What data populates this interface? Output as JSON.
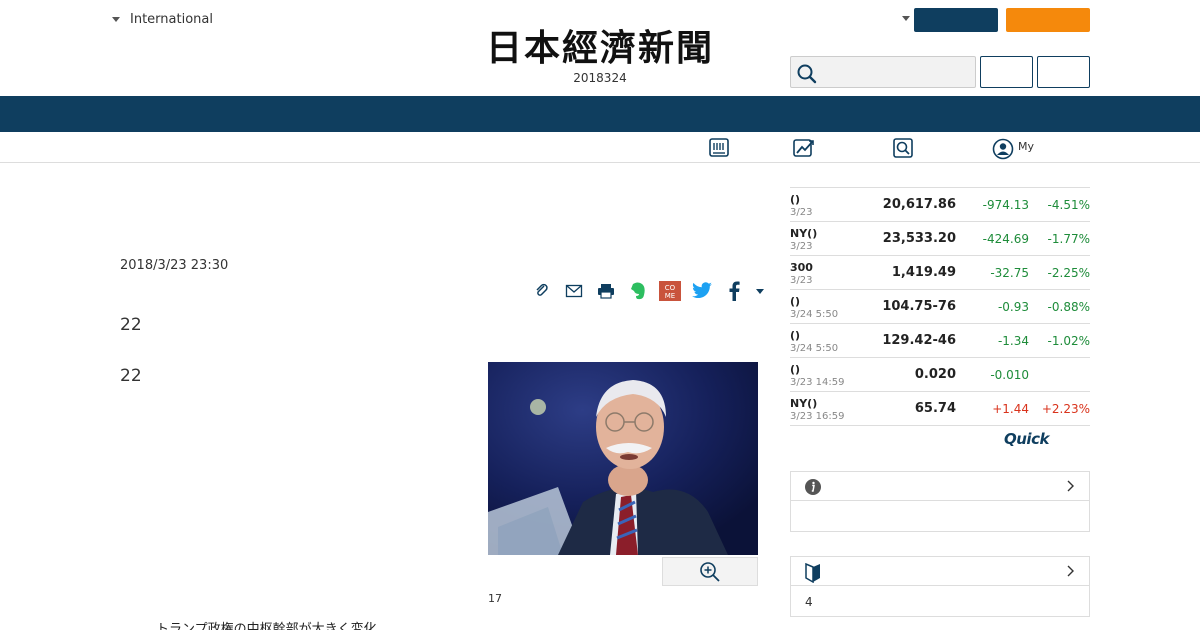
{
  "header": {
    "edition": "International",
    "logo": "日本經濟新聞",
    "date": "2018324"
  },
  "subnav": {
    "my_label": "My",
    "icons": [
      "newspaper-icon",
      "chart-icon",
      "search-news-icon",
      "user-icon"
    ]
  },
  "article": {
    "timestamp": "2018/3/23 23:30",
    "para1": "22",
    "para2": "22",
    "photo_caption": "17",
    "bottom_text": "トランプ政権の中枢幹部が大きく変化",
    "share_icons": [
      "clip-icon",
      "mail-icon",
      "print-icon",
      "evernote-icon",
      "come-icon",
      "twitter-icon",
      "facebook-icon",
      "more-caret-icon"
    ]
  },
  "market": {
    "rows": [
      {
        "name": "()",
        "time": "3/23",
        "value": "20,617.86",
        "change": "-974.13",
        "pct": "-4.51%",
        "dir": "down"
      },
      {
        "name": "NY()",
        "time": "3/23",
        "value": "23,533.20",
        "change": "-424.69",
        "pct": "-1.77%",
        "dir": "down"
      },
      {
        "name": "300",
        "time": "3/23",
        "value": "1,419.49",
        "change": "-32.75",
        "pct": "-2.25%",
        "dir": "down"
      },
      {
        "name": "()",
        "time": "3/24 5:50",
        "value": "104.75-76",
        "change": "-0.93",
        "pct": "-0.88%",
        "dir": "down"
      },
      {
        "name": "()",
        "time": "3/24 5:50",
        "value": "129.42-46",
        "change": "-1.34",
        "pct": "-1.02%",
        "dir": "down"
      },
      {
        "name": "()",
        "time": "3/23 14:59",
        "value": "0.020",
        "change": "-0.010",
        "pct": "",
        "dir": "down"
      },
      {
        "name": "NY()",
        "time": "3/23 16:59",
        "value": "65.74",
        "change": "+1.44",
        "pct": "+2.23%",
        "dir": "up"
      }
    ],
    "source_label": "Quick"
  },
  "panels": {
    "info_body": "",
    "beginner_body": "4"
  },
  "colors": {
    "navy": "#0f3e5f",
    "orange": "#f5890c",
    "down": "#1e8c3a",
    "up": "#d9331c"
  }
}
